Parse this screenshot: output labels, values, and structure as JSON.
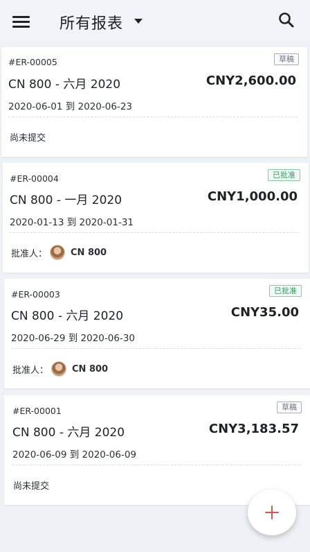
{
  "header": {
    "title": "所有报表",
    "menu_icon": "menu-icon",
    "dropdown_icon": "caret-down-icon",
    "search_icon": "search-icon"
  },
  "reports": [
    {
      "id": "#ER-00005",
      "name": "CN 800 -  六月  2020",
      "amount": "CNY2,600.00",
      "dates": "2020-06-01 到 2020-06-23",
      "status": "草稿",
      "status_type": "draft",
      "footer": "尚未提交"
    },
    {
      "id": "#ER-00004",
      "name": "CN 800 -  一月  2020",
      "amount": "CNY1,000.00",
      "dates": "2020-01-13 到 2020-01-31",
      "status": "已批准",
      "status_type": "approved",
      "approver_label": "批准人：",
      "approver_name": "CN 800"
    },
    {
      "id": "#ER-00003",
      "name": "CN 800 -  六月  2020",
      "amount": "CNY35.00",
      "dates": "2020-06-29 到 2020-06-30",
      "status": "已批准",
      "status_type": "approved",
      "approver_label": "批准人：",
      "approver_name": "CN 800"
    },
    {
      "id": "#ER-00001",
      "name": "CN 800 -  六月  2020",
      "amount": "CNY3,183.57",
      "dates": "2020-06-09 到 2020-06-09",
      "status": "草稿",
      "status_type": "draft",
      "footer": "尚未提交"
    }
  ],
  "fab": {
    "icon": "plus-icon"
  },
  "colors": {
    "background": "#eef1f6",
    "approved": "#2e9e5b",
    "fab_plus": "#d9534f"
  }
}
